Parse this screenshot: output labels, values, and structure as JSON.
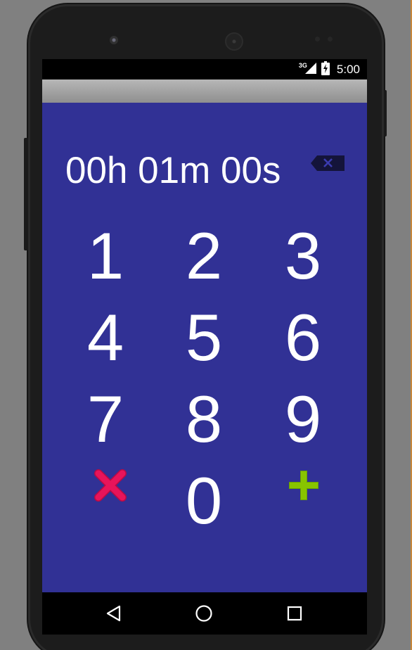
{
  "status_bar": {
    "network_type": "3G",
    "time": "5:00",
    "icons": [
      "signal-icon",
      "battery-charging-icon"
    ]
  },
  "timer": {
    "display": "00h 01m 00s",
    "backspace_icon": "backspace-icon"
  },
  "keypad": {
    "keys": [
      "1",
      "2",
      "3",
      "4",
      "5",
      "6",
      "7",
      "8",
      "9",
      "0"
    ],
    "cancel_icon": "cancel-icon",
    "add_icon": "add-icon"
  },
  "navigation": {
    "icons": [
      "back-icon",
      "home-icon",
      "recents-icon"
    ]
  },
  "colors": {
    "background": "#313195",
    "text": "#ffffff",
    "cancel": "#e8145a",
    "add": "#88c400",
    "backspace_fill": "#14143a"
  }
}
